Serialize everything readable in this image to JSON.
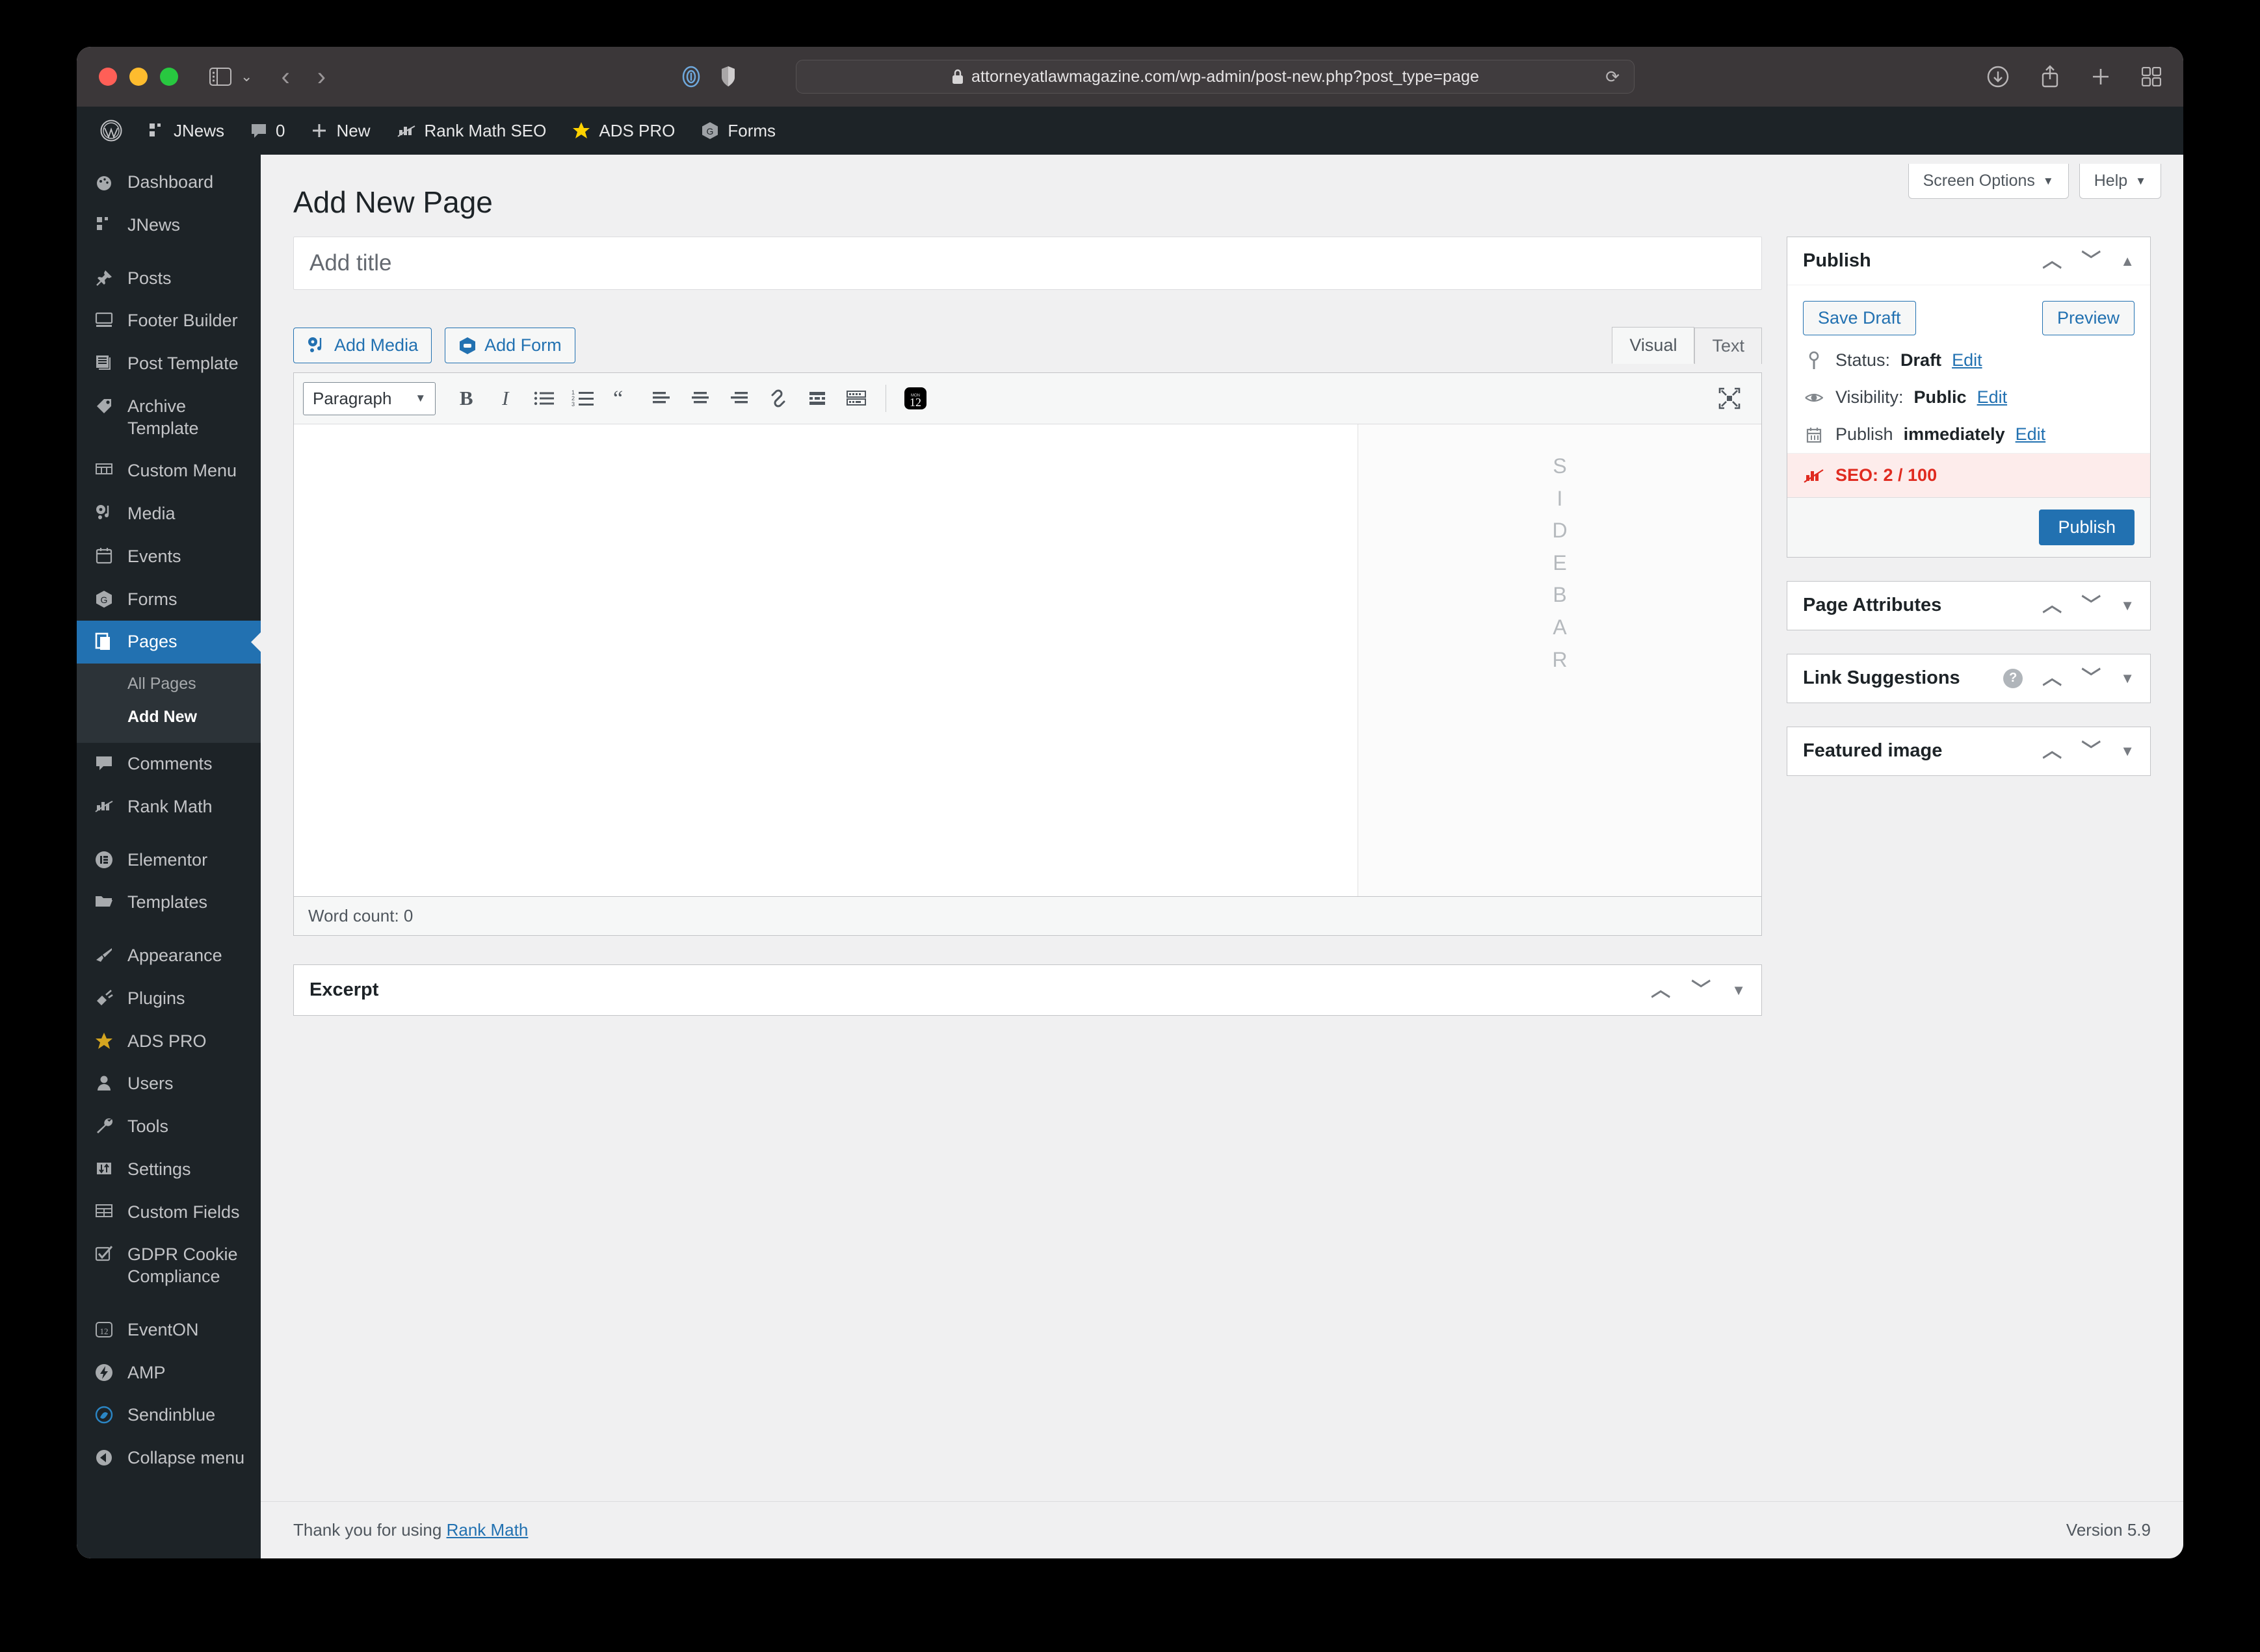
{
  "browser": {
    "url": "attorneyatlawmagazine.com/wp-admin/post-new.php?post_type=page",
    "lock_icon": "lock-icon",
    "reload_icon": "reload-icon",
    "back_icon": "back-chevron-icon",
    "forward_icon": "forward-chevron-icon",
    "sidebar_toggle_icon": "sidebar-toggle-icon",
    "reader_icon": "reader-icon",
    "shield_icon": "privacy-shield-icon",
    "downloads_icon": "downloads-icon",
    "share_icon": "share-icon",
    "newtab_icon": "new-tab-icon",
    "taboverview_icon": "tab-overview-icon"
  },
  "adminbar": {
    "items": [
      {
        "label": "",
        "icon": "wordpress-logo-icon"
      },
      {
        "label": "JNews",
        "icon": "jnews-icon"
      },
      {
        "label": "0",
        "icon": "comment-bubble-icon"
      },
      {
        "label": "New",
        "icon": "plus-icon"
      },
      {
        "label": "Rank Math SEO",
        "icon": "rank-math-icon"
      },
      {
        "label": "ADS PRO",
        "icon": "ads-pro-star-icon"
      },
      {
        "label": "Forms",
        "icon": "forms-icon"
      }
    ]
  },
  "sidebar": {
    "groups": [
      {
        "items": [
          {
            "label": "Dashboard",
            "icon": "dashboard-icon"
          },
          {
            "label": "JNews",
            "icon": "jnews-icon"
          }
        ]
      },
      {
        "items": [
          {
            "label": "Posts",
            "icon": "pin-icon"
          },
          {
            "label": "Footer Builder",
            "icon": "screen-icon"
          },
          {
            "label": "Post Template",
            "icon": "document-icon"
          },
          {
            "label": "Archive Template",
            "icon": "tag-icon"
          },
          {
            "label": "Custom Menu",
            "icon": "menu-grid-icon"
          },
          {
            "label": "Media",
            "icon": "media-icon"
          },
          {
            "label": "Events",
            "icon": "calendar-icon"
          },
          {
            "label": "Forms",
            "icon": "forms-icon"
          },
          {
            "label": "Pages",
            "icon": "pages-icon",
            "active": true
          },
          {
            "label": "Comments",
            "icon": "comment-bubble-icon"
          },
          {
            "label": "Rank Math",
            "icon": "rank-math-icon"
          }
        ]
      },
      {
        "items": [
          {
            "label": "Elementor",
            "icon": "elementor-icon"
          },
          {
            "label": "Templates",
            "icon": "folder-icon"
          }
        ]
      },
      {
        "items": [
          {
            "label": "Appearance",
            "icon": "paintbrush-icon"
          },
          {
            "label": "Plugins",
            "icon": "plug-icon"
          },
          {
            "label": "ADS PRO",
            "icon": "ads-pro-star-icon"
          },
          {
            "label": "Users",
            "icon": "user-icon"
          },
          {
            "label": "Tools",
            "icon": "wrench-icon"
          },
          {
            "label": "Settings",
            "icon": "sliders-icon"
          },
          {
            "label": "Custom Fields",
            "icon": "table-icon"
          },
          {
            "label": "GDPR Cookie Compliance",
            "icon": "checkbox-icon"
          }
        ]
      },
      {
        "items": [
          {
            "label": "EventON",
            "icon": "eventon-calendar-icon"
          },
          {
            "label": "AMP",
            "icon": "amp-bolt-icon"
          },
          {
            "label": "Sendinblue",
            "icon": "sendinblue-icon"
          },
          {
            "label": "Collapse menu",
            "icon": "collapse-arrow-icon"
          }
        ]
      }
    ],
    "submenu": {
      "parent": "Pages",
      "items": [
        {
          "label": "All Pages",
          "current": false
        },
        {
          "label": "Add New",
          "current": true
        }
      ]
    }
  },
  "screen_meta": {
    "screen_options": "Screen Options",
    "help": "Help",
    "caret_icon": "chevron-down-icon"
  },
  "main": {
    "page_title": "Add New Page",
    "title_placeholder": "Add title",
    "add_media": "Add Media",
    "add_form": "Add Form",
    "media_icon": "add-media-icon",
    "form_icon": "add-form-icon",
    "tabs": [
      {
        "label": "Visual",
        "active": true
      },
      {
        "label": "Text",
        "active": false
      }
    ],
    "toolbar": {
      "format_select": "Paragraph",
      "format_caret_icon": "chevron-down-icon",
      "buttons": [
        {
          "name": "bold-icon",
          "glyph": "B"
        },
        {
          "name": "italic-icon",
          "glyph": "I"
        },
        {
          "name": "bulleted-list-icon",
          "glyph": ""
        },
        {
          "name": "numbered-list-icon",
          "glyph": ""
        },
        {
          "name": "blockquote-icon",
          "glyph": "“"
        },
        {
          "name": "align-left-icon",
          "glyph": ""
        },
        {
          "name": "align-center-icon",
          "glyph": ""
        },
        {
          "name": "align-right-icon",
          "glyph": ""
        },
        {
          "name": "insert-link-icon",
          "glyph": ""
        },
        {
          "name": "read-more-icon",
          "glyph": ""
        },
        {
          "name": "toolbar-toggle-icon",
          "glyph": ""
        },
        {
          "name": "eventon-calendar-icon",
          "glyph": "12"
        }
      ],
      "fullscreen_icon": "fullscreen-icon"
    },
    "canvas_placeholder": "SIDEBAR",
    "word_count": "Word count: 0",
    "excerpt": {
      "title": "Excerpt",
      "controls": [
        "chevron-up-icon",
        "chevron-down-icon",
        "triangle-down-icon"
      ]
    }
  },
  "publish_box": {
    "title": "Publish",
    "controls": [
      "chevron-up-icon",
      "chevron-down-icon",
      "triangle-up-icon"
    ],
    "save_draft": "Save Draft",
    "preview": "Preview",
    "status_label": "Status:",
    "status_value": "Draft",
    "status_edit": "Edit",
    "status_icon": "pin-marker-icon",
    "visibility_label": "Visibility:",
    "visibility_value": "Public",
    "visibility_edit": "Edit",
    "visibility_icon": "eye-icon",
    "publish_label": "Publish",
    "publish_value": "immediately",
    "publish_edit": "Edit",
    "publish_icon": "calendar-icon",
    "seo_icon": "rank-math-icon",
    "seo_text": "SEO: 2 / 100",
    "seo_color": "#e02b20",
    "publish_button": "Publish"
  },
  "side_boxes": [
    {
      "title": "Page Attributes",
      "has_help": false,
      "controls": [
        "chevron-up-icon",
        "chevron-down-icon",
        "triangle-down-icon"
      ]
    },
    {
      "title": "Link Suggestions",
      "has_help": true,
      "help_icon": "help-question-icon",
      "controls": [
        "chevron-up-icon",
        "chevron-down-icon",
        "triangle-down-icon"
      ]
    },
    {
      "title": "Featured image",
      "has_help": false,
      "controls": [
        "chevron-up-icon",
        "chevron-down-icon",
        "triangle-down-icon"
      ]
    }
  ],
  "footer": {
    "thanks_prefix": "Thank you for using ",
    "thanks_link": "Rank Math",
    "version": "Version 5.9"
  },
  "colors": {
    "wp_blue": "#2271b1",
    "sidebar_bg": "#1d2327",
    "admin_bg": "#f0f0f1",
    "seo_red": "#e02b20",
    "seo_bg": "#fdeceb"
  }
}
